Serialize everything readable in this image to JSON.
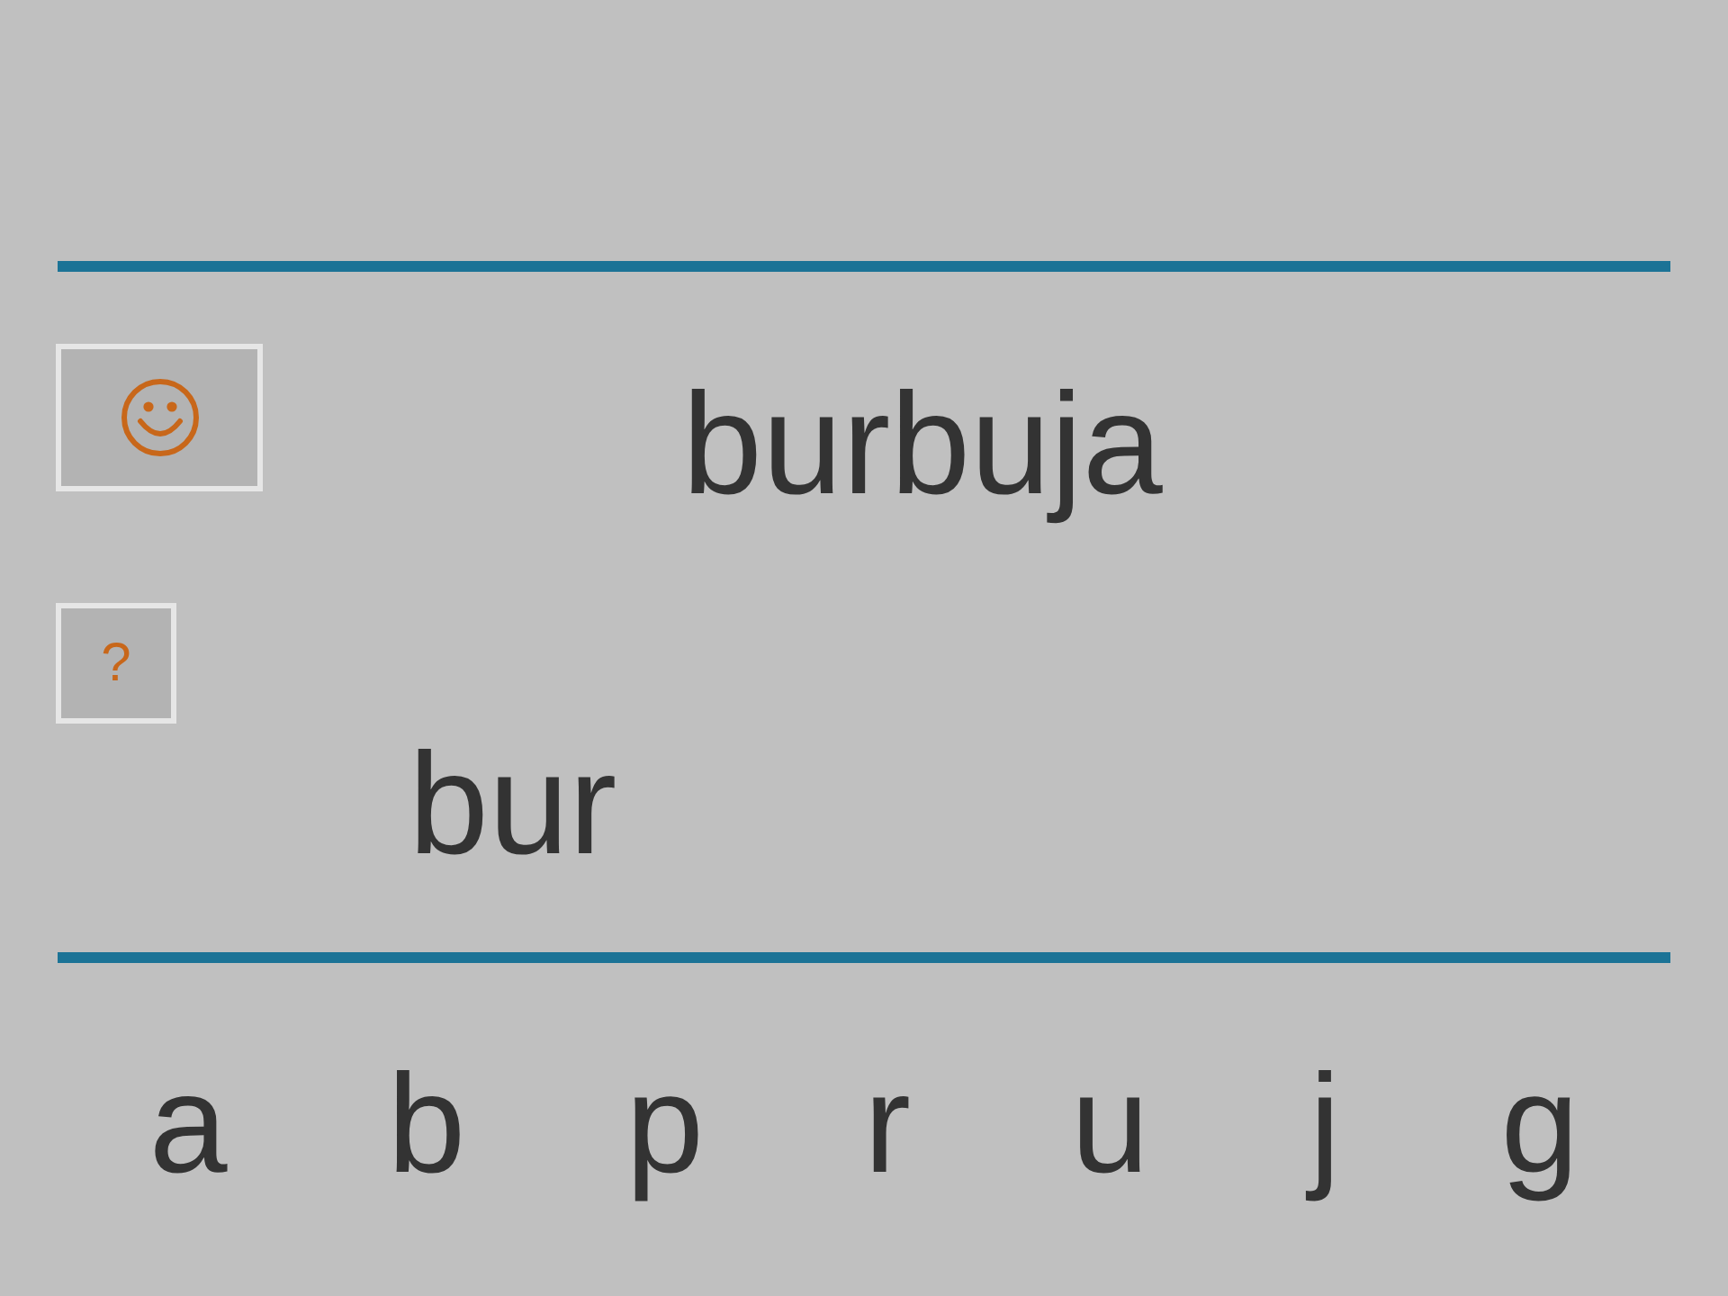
{
  "prompt_word": "burbuja",
  "help_button": {
    "label": "?"
  },
  "answer": "bur",
  "letters": [
    "a",
    "b",
    "p",
    "r",
    "u",
    "j",
    "g"
  ]
}
